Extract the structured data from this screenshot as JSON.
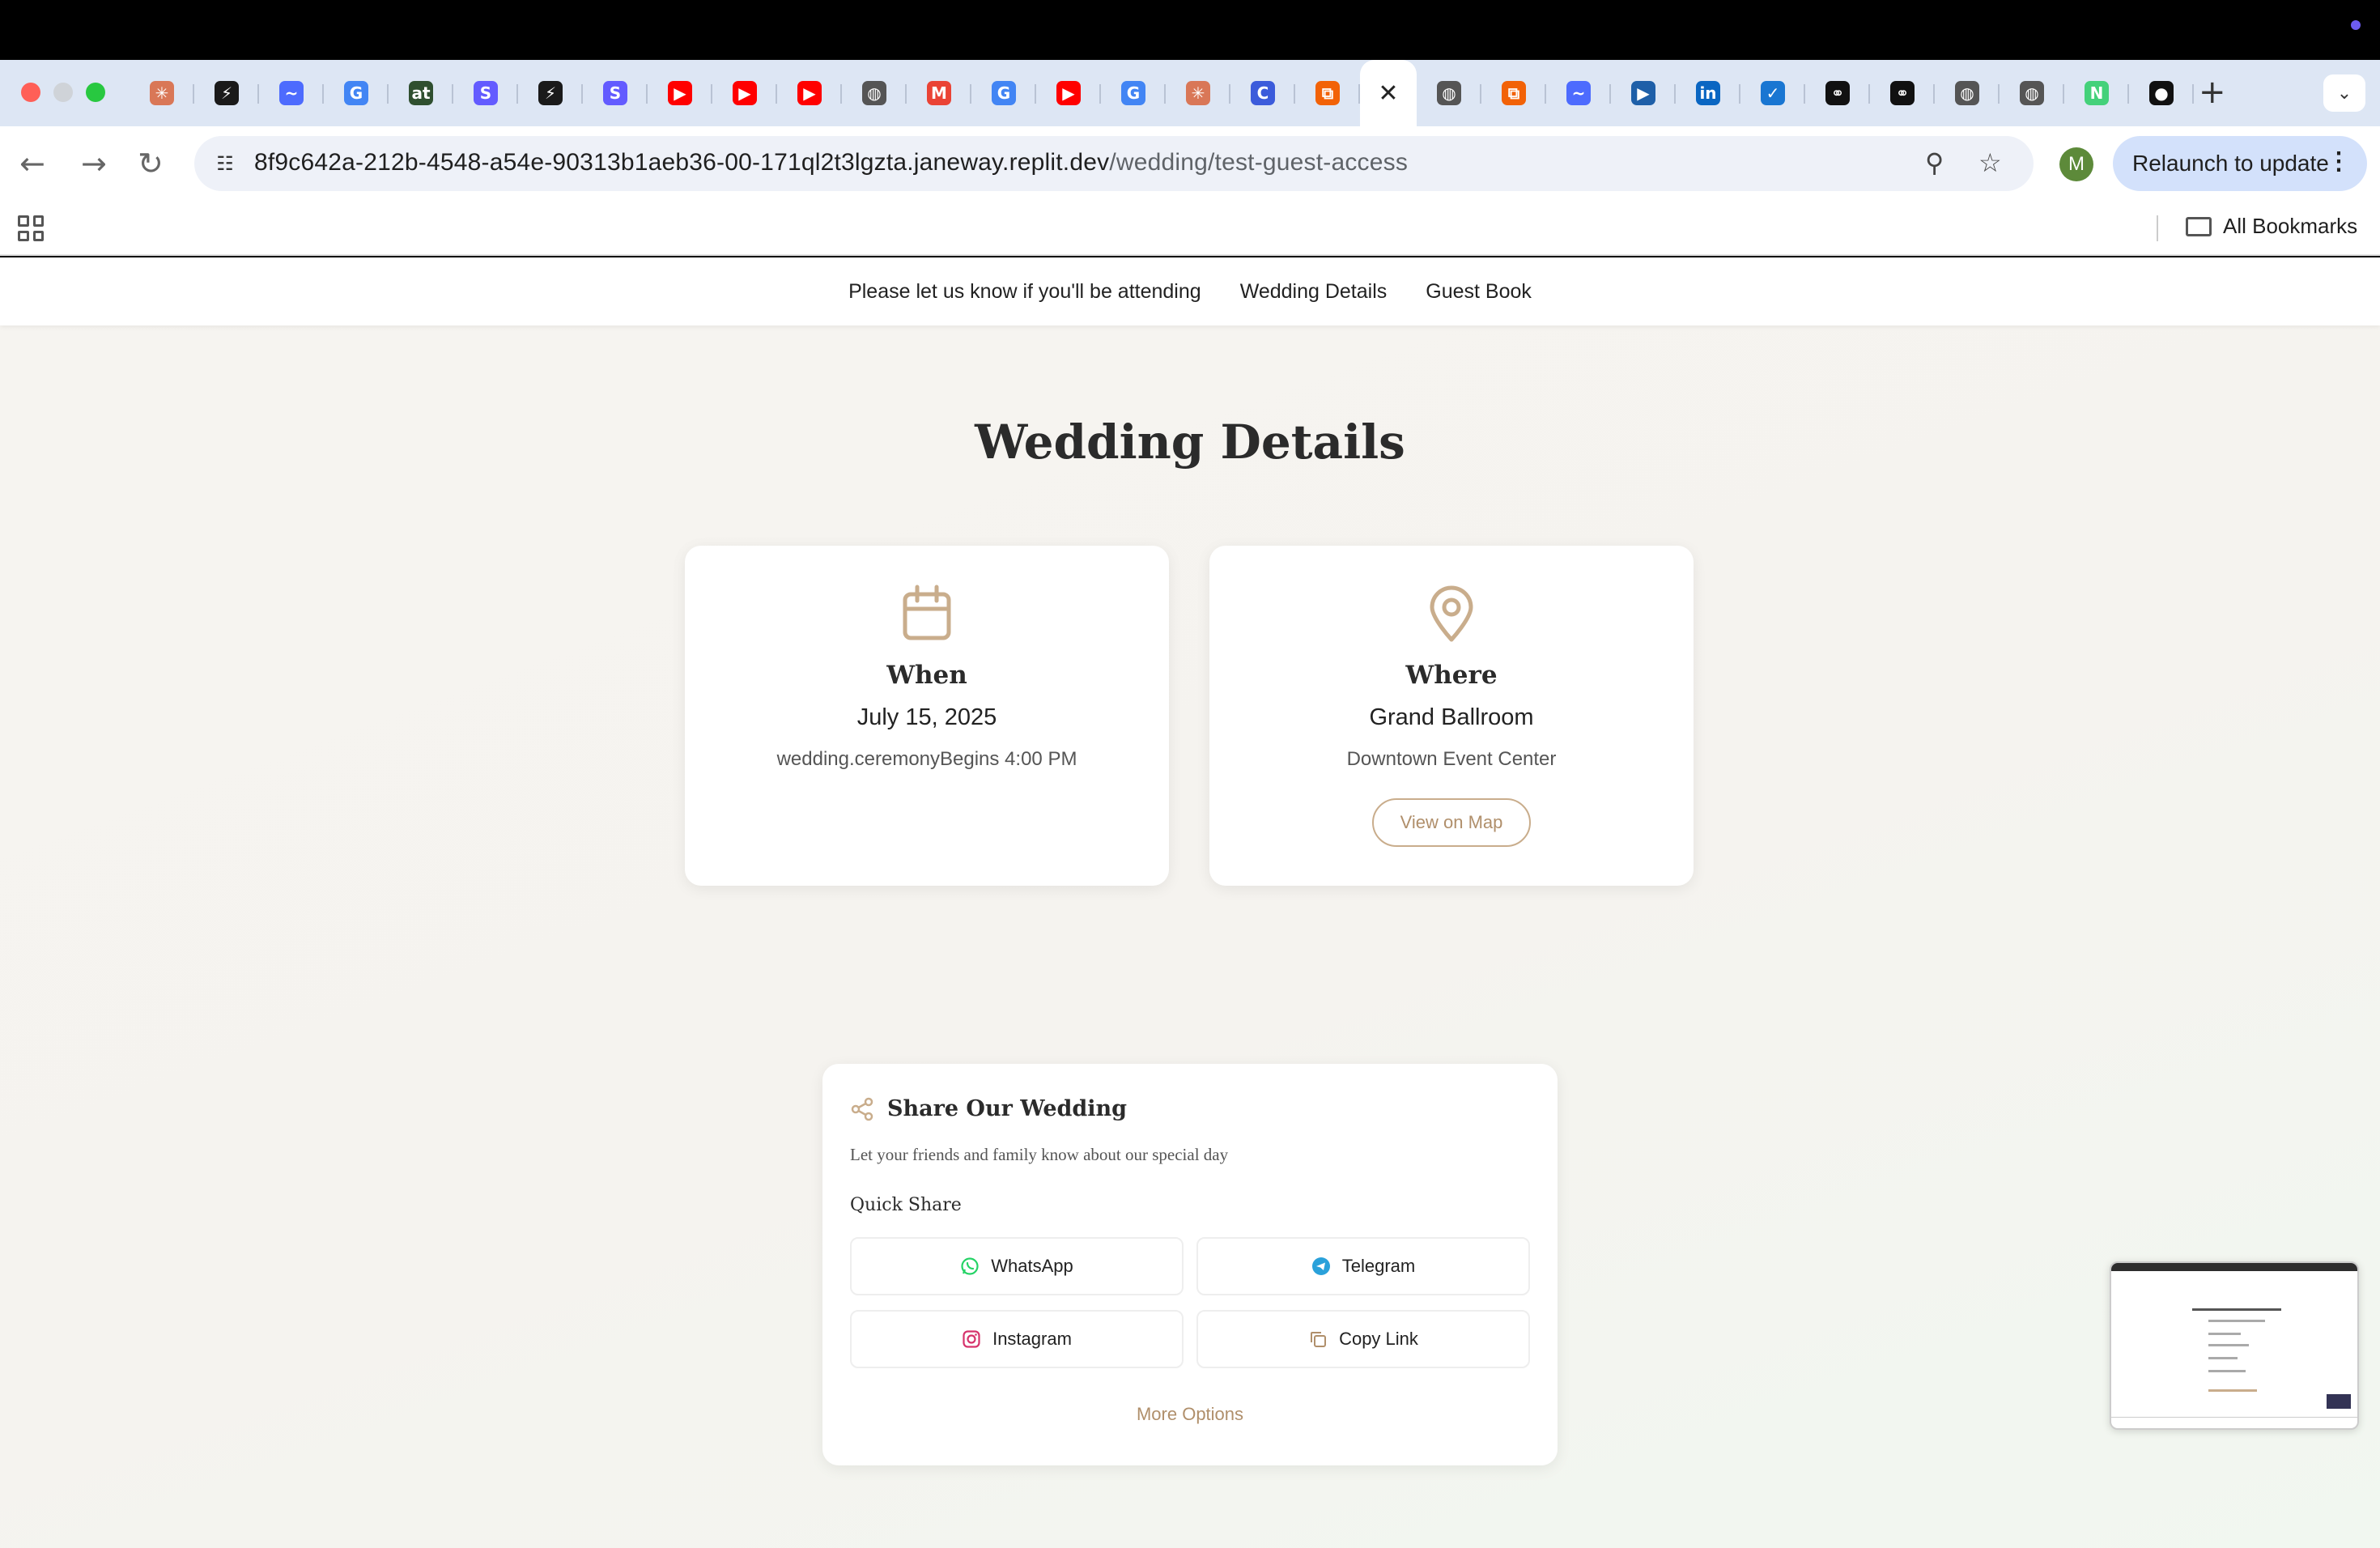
{
  "browser": {
    "address": {
      "host": "8f9c642a-212b-4548-a54e-90313b1aeb36-00-171ql2t3lgzta.janeway.replit.dev",
      "path": "/wedding/test-guest-access"
    },
    "profile_initial": "M",
    "relaunch_label": "Relaunch to update",
    "bookmarks_label": "All Bookmarks",
    "tabs": [
      {
        "icon": "claude-icon",
        "color": "#d97757",
        "glyph": "✳"
      },
      {
        "icon": "bolt-icon",
        "color": "#1a1a1a",
        "glyph": "⚡"
      },
      {
        "icon": "deepseek-icon",
        "color": "#4d6bfe",
        "glyph": "~"
      },
      {
        "icon": "google-icon",
        "color": "#4285f4",
        "glyph": "G"
      },
      {
        "icon": "at-icon",
        "color": "#2f4f2f",
        "glyph": "at"
      },
      {
        "icon": "stripe-icon",
        "color": "#635bff",
        "glyph": "S"
      },
      {
        "icon": "bolt-icon",
        "color": "#1a1a1a",
        "glyph": "⚡"
      },
      {
        "icon": "stripe-icon",
        "color": "#635bff",
        "glyph": "S"
      },
      {
        "icon": "youtube-icon",
        "color": "#ff0000",
        "glyph": "▶"
      },
      {
        "icon": "youtube-icon",
        "color": "#ff0000",
        "glyph": "▶"
      },
      {
        "icon": "youtube-icon",
        "color": "#ff0000",
        "glyph": "▶"
      },
      {
        "icon": "globe-icon",
        "color": "#555555",
        "glyph": "◍"
      },
      {
        "icon": "gmail-icon",
        "color": "#ea4335",
        "glyph": "M"
      },
      {
        "icon": "google-icon",
        "color": "#4285f4",
        "glyph": "G"
      },
      {
        "icon": "youtube-icon",
        "color": "#ff0000",
        "glyph": "▶"
      },
      {
        "icon": "google-icon",
        "color": "#4285f4",
        "glyph": "G"
      },
      {
        "icon": "claude-icon",
        "color": "#d97757",
        "glyph": "✳"
      },
      {
        "icon": "c-icon",
        "color": "#3b5bdb",
        "glyph": "C"
      },
      {
        "icon": "replit-icon",
        "color": "#f26207",
        "glyph": "⧉"
      }
    ],
    "tabs_after": [
      {
        "icon": "globe-icon",
        "color": "#555555",
        "glyph": "◍"
      },
      {
        "icon": "replit-icon",
        "color": "#f26207",
        "glyph": "⧉"
      },
      {
        "icon": "deepseek-icon",
        "color": "#4d6bfe",
        "glyph": "~"
      },
      {
        "icon": "video-icon",
        "color": "#1e5fa8",
        "glyph": "▶"
      },
      {
        "icon": "linkedin-icon",
        "color": "#0a66c2",
        "glyph": "in"
      },
      {
        "icon": "tasks-icon",
        "color": "#1976d2",
        "glyph": "✓"
      },
      {
        "icon": "link-icon",
        "color": "#111111",
        "glyph": "⚭"
      },
      {
        "icon": "link-check-icon",
        "color": "#111111",
        "glyph": "⚭"
      },
      {
        "icon": "globe-icon",
        "color": "#555555",
        "glyph": "◍"
      },
      {
        "icon": "globe-icon",
        "color": "#555555",
        "glyph": "◍"
      },
      {
        "icon": "n-icon",
        "color": "#44d17a",
        "glyph": "N"
      },
      {
        "icon": "github-icon",
        "color": "#111111",
        "glyph": "●"
      }
    ]
  },
  "site_nav": {
    "items": [
      {
        "label": "Please let us know if you'll be attending"
      },
      {
        "label": "Wedding Details"
      },
      {
        "label": "Guest Book"
      }
    ]
  },
  "details": {
    "heading": "Wedding Details",
    "when": {
      "title": "When",
      "date": "July 15, 2025",
      "time": "wedding.ceremonyBegins 4:00 PM"
    },
    "where": {
      "title": "Where",
      "venue": "Grand Ballroom",
      "location": "Downtown Event Center",
      "map_button": "View on Map"
    }
  },
  "share": {
    "title": "Share Our Wedding",
    "description": "Let your friends and family know about our special day",
    "quick_label": "Quick Share",
    "buttons": [
      {
        "label": "WhatsApp",
        "color": "#25d366"
      },
      {
        "label": "Telegram",
        "color": "#2aa1da"
      },
      {
        "label": "Instagram",
        "color": "#d6336c"
      },
      {
        "label": "Copy Link",
        "color": "#b08f6b"
      }
    ],
    "more_label": "More Options"
  },
  "colors": {
    "accent": "#c9ad8c",
    "accent_text": "#b08f6b",
    "background": "#f6f4f0"
  }
}
